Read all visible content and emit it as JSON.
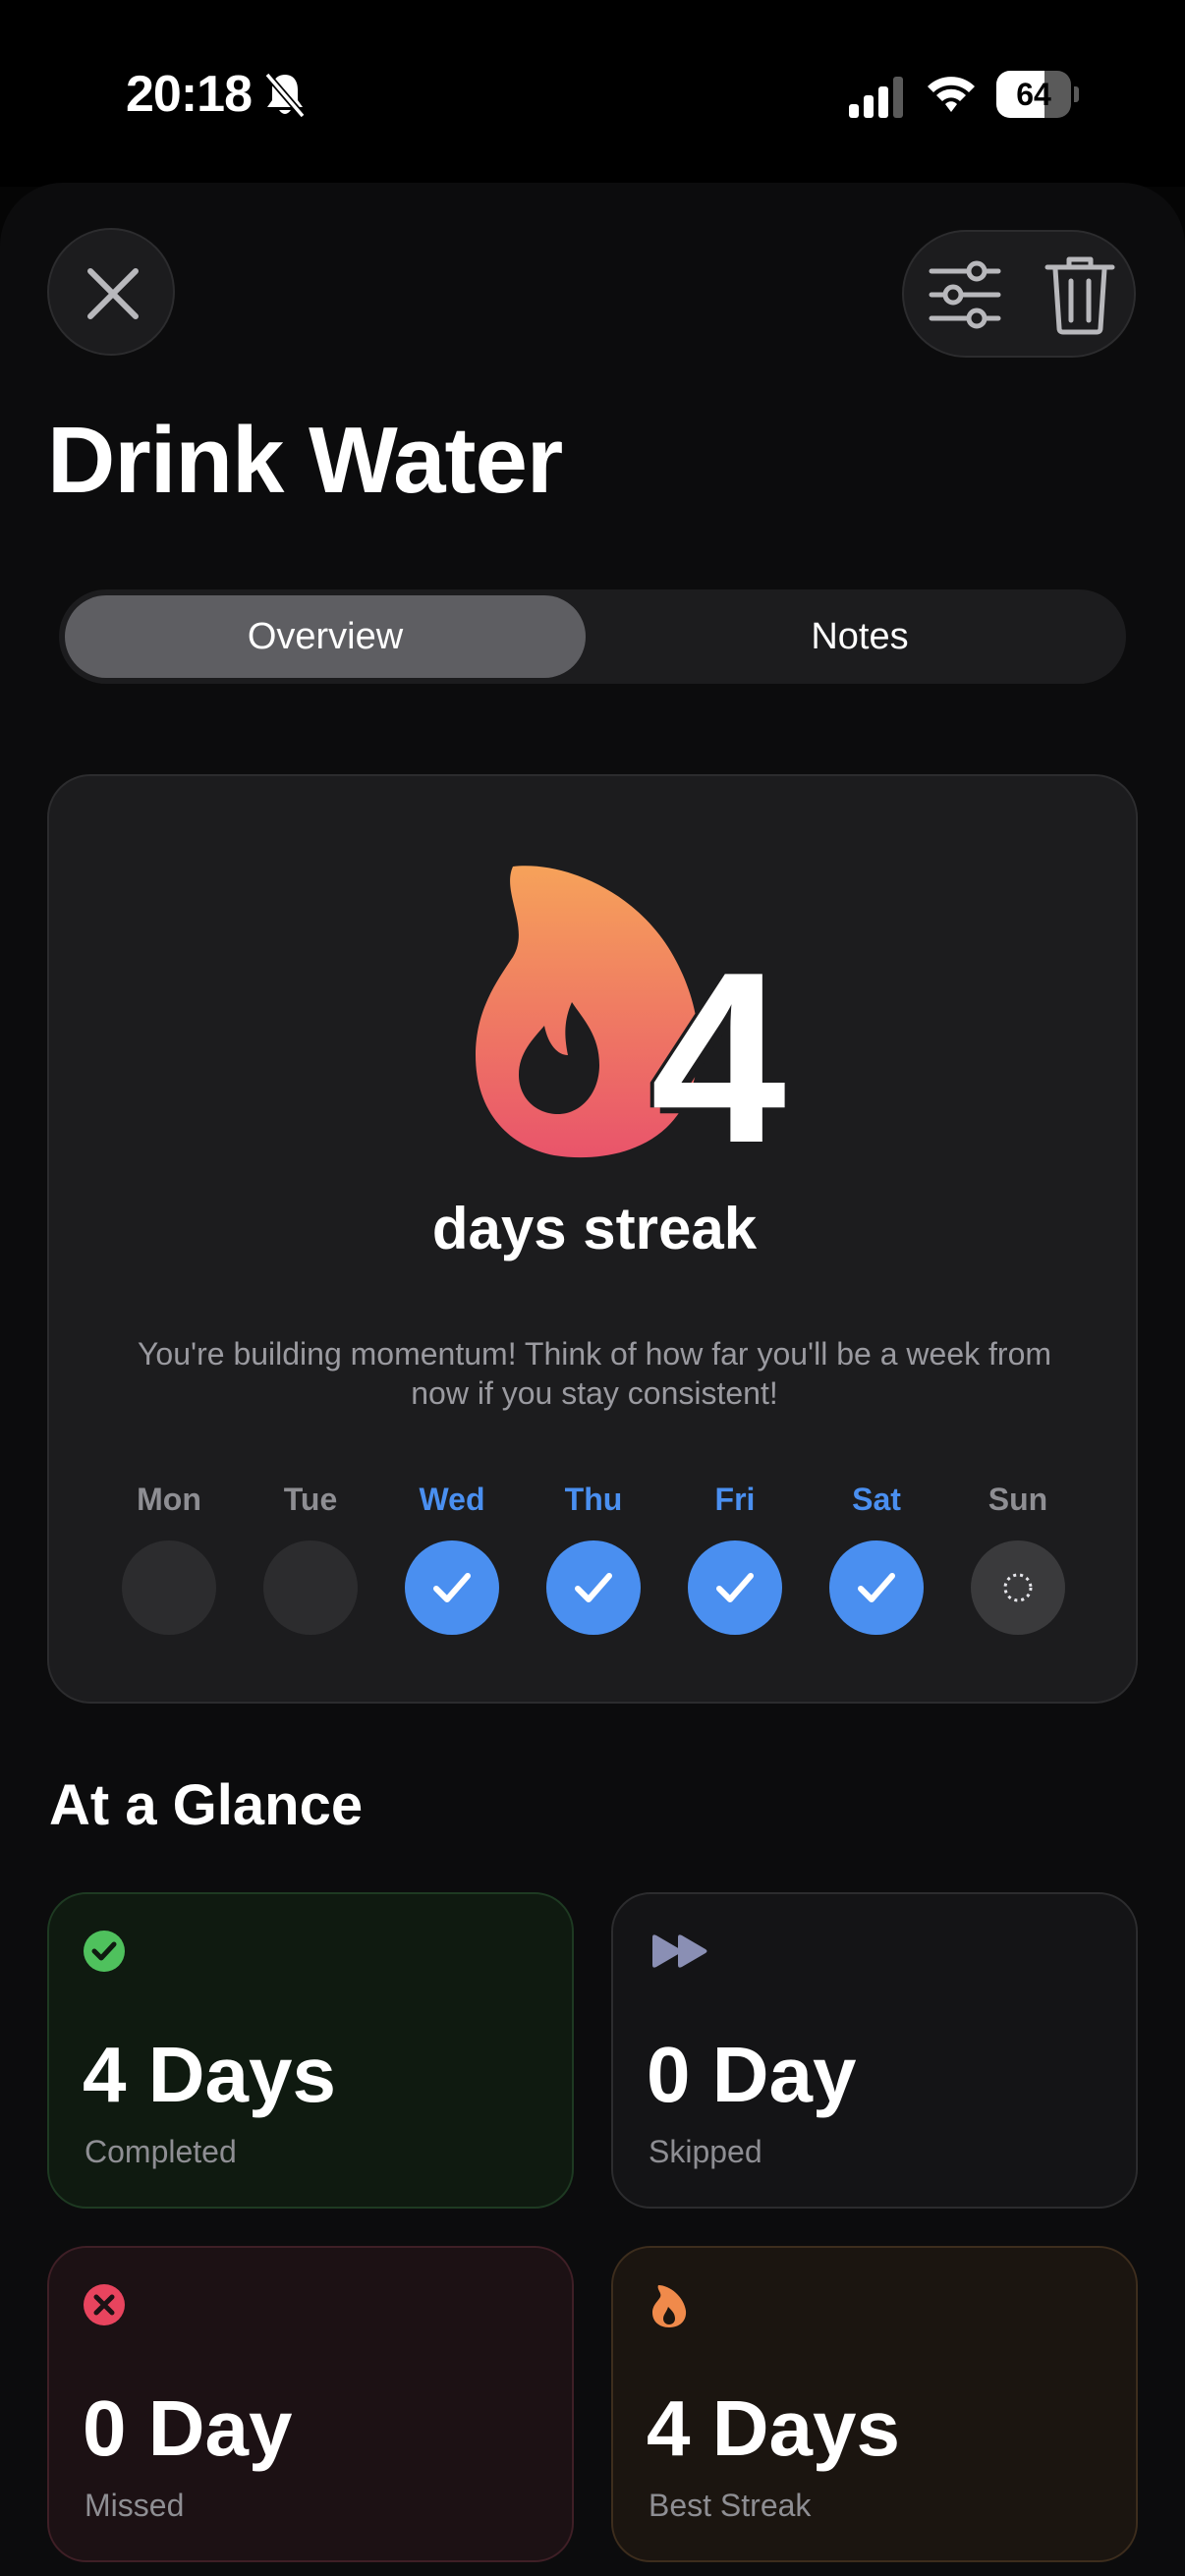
{
  "status_bar": {
    "time": "20:18",
    "battery_percent": "64",
    "battery_level": 0.64
  },
  "header": {
    "title": "Drink Water"
  },
  "tabs": [
    {
      "label": "Overview",
      "selected": true
    },
    {
      "label": "Notes",
      "selected": false
    }
  ],
  "streak": {
    "count": "4",
    "label": "days streak",
    "message": "You're building momentum! Think of how far you'll be a week from now if you stay consistent!",
    "days": [
      {
        "label": "Mon",
        "state": "empty"
      },
      {
        "label": "Tue",
        "state": "empty"
      },
      {
        "label": "Wed",
        "state": "done"
      },
      {
        "label": "Thu",
        "state": "done"
      },
      {
        "label": "Fri",
        "state": "done"
      },
      {
        "label": "Sat",
        "state": "done"
      },
      {
        "label": "Sun",
        "state": "pending"
      }
    ]
  },
  "glance": {
    "title": "At a Glance",
    "cards": [
      {
        "value": "4 Days",
        "label": "Completed",
        "icon": "checkmark-circle-icon",
        "accent": "#4fc15d"
      },
      {
        "value": "0 Day",
        "label": "Skipped",
        "icon": "fast-forward-icon",
        "accent": "#8a8fb4"
      },
      {
        "value": "0 Day",
        "label": "Missed",
        "icon": "x-circle-icon",
        "accent": "#e8445e"
      },
      {
        "value": "4 Days",
        "label": "Best Streak",
        "icon": "flame-icon",
        "accent": "#f08a4b"
      }
    ]
  },
  "colors": {
    "accent_blue": "#4a8ff0",
    "flame_top": "#f6a25a",
    "flame_bottom": "#e9546b"
  }
}
